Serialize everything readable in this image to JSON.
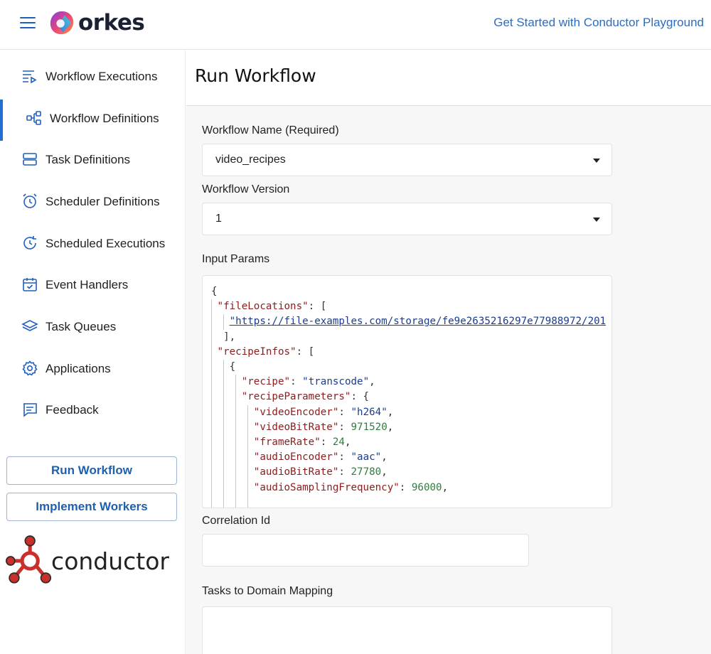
{
  "header": {
    "brand": "orkes",
    "get_started_link": "Get Started with Conductor Playground"
  },
  "sidebar": {
    "items": [
      {
        "label": "Workflow Executions",
        "icon": "workflow-executions-icon"
      },
      {
        "label": "Workflow Definitions",
        "icon": "workflow-definitions-icon",
        "active": true
      },
      {
        "label": "Task Definitions",
        "icon": "task-definitions-icon"
      },
      {
        "label": "Scheduler Definitions",
        "icon": "alarm-clock-icon"
      },
      {
        "label": "Scheduled Executions",
        "icon": "refresh-clock-icon"
      },
      {
        "label": "Event Handlers",
        "icon": "calendar-check-icon"
      },
      {
        "label": "Task Queues",
        "icon": "layers-icon"
      },
      {
        "label": "Applications",
        "icon": "gear-icon"
      },
      {
        "label": "Feedback",
        "icon": "feedback-icon"
      }
    ],
    "run_workflow_button": "Run Workflow",
    "implement_workers_button": "Implement Workers",
    "conductor_logo_text": "conductor"
  },
  "main": {
    "title": "Run Workflow",
    "workflow_name_label": "Workflow Name (Required)",
    "workflow_name_value": "video_recipes",
    "workflow_version_label": "Workflow Version",
    "workflow_version_value": "1",
    "input_params_label": "Input Params",
    "input_params_code": {
      "open_brace": "{",
      "file_locations_key": "\"fileLocations\"",
      "file_locations_url": "\"https://file-examples.com/storage/fe9e2635216297e77988972/201",
      "recipe_infos_key": "\"recipeInfos\"",
      "recipe_key": "\"recipe\"",
      "recipe_value": "\"transcode\"",
      "recipe_parameters_key": "\"recipeParameters\"",
      "video_encoder_key": "\"videoEncoder\"",
      "video_encoder_value": "\"h264\"",
      "video_bit_rate_key": "\"videoBitRate\"",
      "video_bit_rate_value": "971520",
      "frame_rate_key": "\"frameRate\"",
      "frame_rate_value": "24",
      "audio_encoder_key": "\"audioEncoder\"",
      "audio_encoder_value": "\"aac\"",
      "audio_bit_rate_key": "\"audioBitRate\"",
      "audio_bit_rate_value": "27780",
      "audio_sampling_key": "\"audioSamplingFrequency\"",
      "audio_sampling_value": "96000"
    },
    "correlation_id_label": "Correlation Id",
    "correlation_id_value": "",
    "tasks_to_domain_label": "Tasks to Domain Mapping",
    "tasks_to_domain_value": ""
  },
  "colors": {
    "accent": "#1f6fd1",
    "link": "#2e6cbf",
    "json_key": "#8b1d1d",
    "json_string": "#1a3d8f",
    "json_number": "#2f7d3f"
  }
}
